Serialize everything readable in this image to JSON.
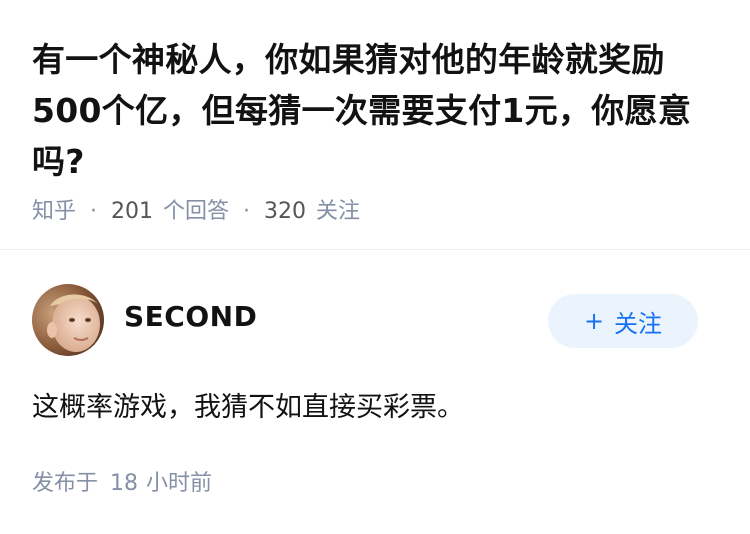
{
  "question": {
    "title": "有一个神秘人，你如果猜对他的年龄就奖励500个亿，但每猜一次需要支付1元，你愿意吗?",
    "source": "知乎",
    "answer_count": "201",
    "answer_count_label": "个回答",
    "follower_count": "320",
    "follower_count_label": "关注",
    "separator": "·"
  },
  "answer": {
    "author": {
      "name": "SECOND",
      "avatar_icon": "child-portrait-avatar"
    },
    "follow_button": {
      "icon": "+",
      "label": "关注"
    },
    "content": "这概率游戏，我猜不如直接买彩票。",
    "published_prefix": "发布于",
    "published_value": "18",
    "published_unit": "小时前"
  },
  "colors": {
    "text_primary": "#121212",
    "text_secondary": "#8590a6",
    "accent": "#1772f6",
    "follow_bg": "#ebf4fd"
  }
}
